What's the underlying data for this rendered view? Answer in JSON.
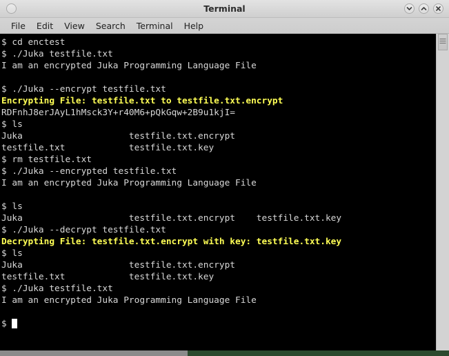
{
  "window": {
    "title": "Terminal",
    "buttons": {
      "menu_circle": "window-menu",
      "minimize": "minimize",
      "maximize": "maximize",
      "close": "close"
    }
  },
  "menu_bar": {
    "items": [
      {
        "label": "File"
      },
      {
        "label": "Edit"
      },
      {
        "label": "View"
      },
      {
        "label": "Search"
      },
      {
        "label": "Terminal"
      },
      {
        "label": "Help"
      }
    ]
  },
  "terminal": {
    "colors": {
      "background": "#000000",
      "foreground": "#d8d8d8",
      "highlight_yellow": "#ffff55"
    },
    "prompt": "$",
    "cursor": "block",
    "lines": [
      {
        "text": "$ cd enctest",
        "style": "normal"
      },
      {
        "text": "$ ./Juka testfile.txt",
        "style": "normal"
      },
      {
        "text": "I am an encrypted Juka Programming Language File",
        "style": "normal"
      },
      {
        "text": "",
        "style": "blank"
      },
      {
        "text": "$ ./Juka --encrypt testfile.txt",
        "style": "normal"
      },
      {
        "text": "Encrypting File: testfile.txt to testfile.txt.encrypt",
        "style": "yellow"
      },
      {
        "text": "RDFnhJ8erJAyL1hMsck3Y+r40M6+pQkGqw+2B9u1kjI=",
        "style": "normal"
      },
      {
        "text": "$ ls",
        "style": "normal"
      },
      {
        "text": "Juka                    testfile.txt.encrypt",
        "style": "normal"
      },
      {
        "text": "testfile.txt            testfile.txt.key",
        "style": "normal"
      },
      {
        "text": "$ rm testfile.txt",
        "style": "normal"
      },
      {
        "text": "$ ./Juka --encrypted testfile.txt",
        "style": "normal"
      },
      {
        "text": "I am an encrypted Juka Programming Language File",
        "style": "normal"
      },
      {
        "text": "",
        "style": "blank"
      },
      {
        "text": "$ ls",
        "style": "normal"
      },
      {
        "text": "Juka                    testfile.txt.encrypt    testfile.txt.key",
        "style": "normal"
      },
      {
        "text": "$ ./Juka --decrypt testfile.txt",
        "style": "normal"
      },
      {
        "text": "Decrypting File: testfile.txt.encrypt with key: testfile.txt.key",
        "style": "yellow"
      },
      {
        "text": "$ ls",
        "style": "normal"
      },
      {
        "text": "Juka                    testfile.txt.encrypt",
        "style": "normal"
      },
      {
        "text": "testfile.txt            testfile.txt.key",
        "style": "normal"
      },
      {
        "text": "$ ./Juka testfile.txt",
        "style": "normal"
      },
      {
        "text": "I am an encrypted Juka Programming Language File",
        "style": "normal"
      },
      {
        "text": "",
        "style": "blank"
      },
      {
        "text": "$ ",
        "style": "cursor"
      }
    ]
  },
  "desktop": {
    "taskbar_color": "#8b8b8b",
    "wallpaper_color": "#2c4a2e"
  }
}
